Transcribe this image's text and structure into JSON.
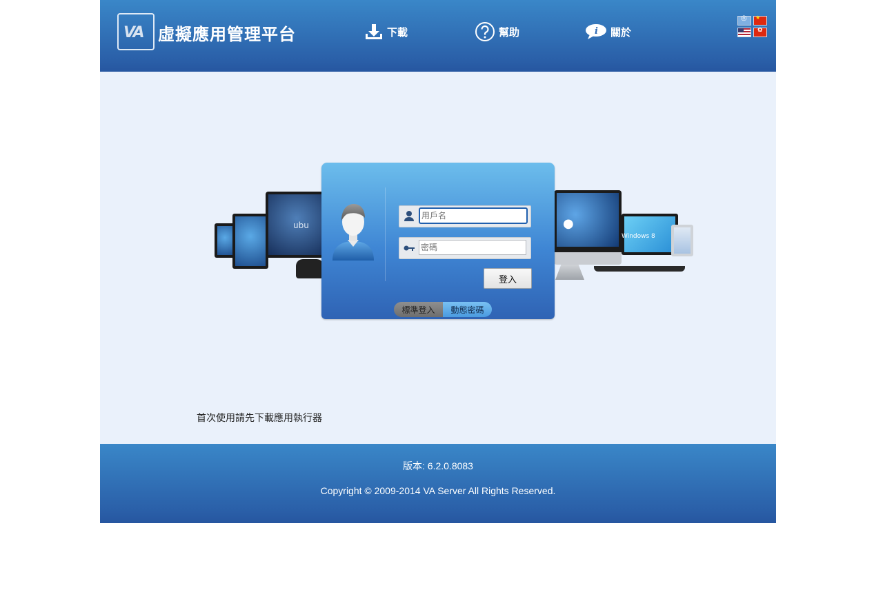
{
  "header": {
    "logo_text": "VA",
    "title": "虛擬應用管理平台",
    "nav": {
      "download": "下載",
      "help": "幫助",
      "about": "關於"
    },
    "languages": [
      "un-language-icon",
      "cn-flag-icon",
      "us-flag-icon",
      "hk-flag-icon"
    ]
  },
  "hero": {
    "ubuntu_text": "ubu",
    "windows_text": "Windows 8"
  },
  "login": {
    "username_placeholder": "用戶名",
    "password_placeholder": "密碼",
    "login_button": "登入",
    "mode_standard": "標準登入",
    "mode_dynamic": "動態密碼"
  },
  "main": {
    "download_hint": "首次使用請先下載應用執行器"
  },
  "footer": {
    "version": "版本: 6.2.0.8083",
    "copyright": "Copyright © 2009-2014 VA Server All Rights Reserved."
  },
  "colors": {
    "header_top": "#3a87c8",
    "header_bottom": "#2656a0",
    "body_bg": "#eaf1fb"
  }
}
